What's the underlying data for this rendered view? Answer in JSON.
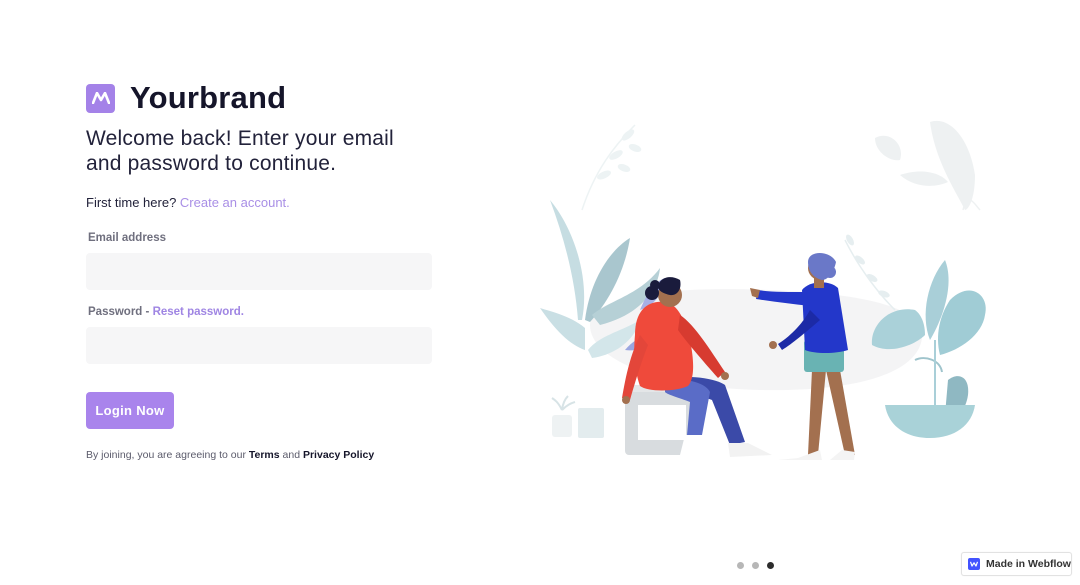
{
  "brand": {
    "name": "Yourbrand",
    "logo_icon": "brand-m-logo",
    "color": "#a482e8"
  },
  "headline": "Welcome back! Enter your email and password to continue.",
  "signup_prompt": {
    "text": "First time here? ",
    "link": "Create an account."
  },
  "form": {
    "email_label": "Email address",
    "email_value": "",
    "password_label": "Password - ",
    "reset_link": "Reset password.",
    "password_value": "",
    "submit_label": "Login Now"
  },
  "terms": {
    "prefix": "By joining, you are agreeing to our ",
    "terms_link": "Terms",
    "middle": " and ",
    "privacy_link": "Privacy Policy"
  },
  "carousel": {
    "slide_count": 3,
    "active_index": 2
  },
  "badge": {
    "label": "Made in Webflow",
    "icon": "webflow-icon",
    "color": "#4353ff"
  },
  "colors": {
    "accent": "#a984ec",
    "link": "#a98fe6",
    "input_bg": "#f6f6f7"
  }
}
